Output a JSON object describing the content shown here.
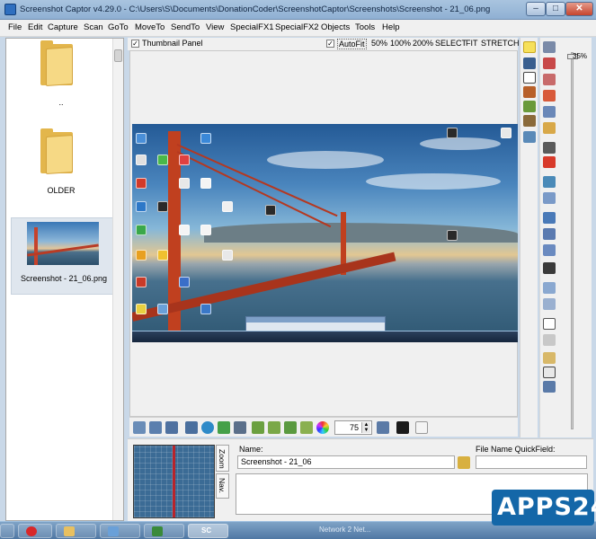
{
  "window": {
    "title": "Screenshot Captor v4.29.0 - C:\\Users\\S\\Documents\\DonationCoder\\ScreenshotCaptor\\Screenshots\\Screenshot - 21_06.png",
    "minimize": "–",
    "maximize": "□",
    "close": "✕"
  },
  "menu": [
    "File",
    "Edit",
    "Capture",
    "Scan",
    "GoTo",
    "MoveTo",
    "SendTo",
    "View",
    "SpecialFX1",
    "SpecialFX2",
    "Objects",
    "Tools",
    "Help"
  ],
  "left_pane": {
    "items": [
      {
        "label": "..",
        "type": "folder"
      },
      {
        "label": "OLDER",
        "type": "folder"
      },
      {
        "label": "Screenshot - 21_06.png",
        "type": "image",
        "selected": true
      }
    ]
  },
  "options": {
    "thumbnail_panel_label": "Thumbnail Panel",
    "thumbnail_panel_checked": "✓",
    "autofit_label": "AutoFit",
    "autofit_checked": "✓",
    "zoom_options": [
      "50%",
      "100%",
      "200%",
      "SELECT",
      "FIT",
      "STRETCH"
    ]
  },
  "viewer_toolbar": {
    "zoom_value": "75",
    "spin_up": "▲",
    "spin_down": "▼"
  },
  "zoom_slider": {
    "label": "35%",
    "level_percent": 35
  },
  "info_panel": {
    "name_label": "Name:",
    "name_value": "Screenshot - 21_06",
    "quickfield_label": "File Name QuickField:",
    "quickfield_value": "",
    "tab_zoom": "Zoom",
    "tab_nav": "Nav."
  },
  "taskbar": {
    "sc_label": "SC",
    "tray_text": "Network 2 Net..."
  },
  "watermark": "APPS24",
  "colors": {
    "titlebar": "#9dbbd9",
    "accent": "#1467a8",
    "bridge_red": "#c0401f",
    "nav_blue": "#3b6b95"
  }
}
